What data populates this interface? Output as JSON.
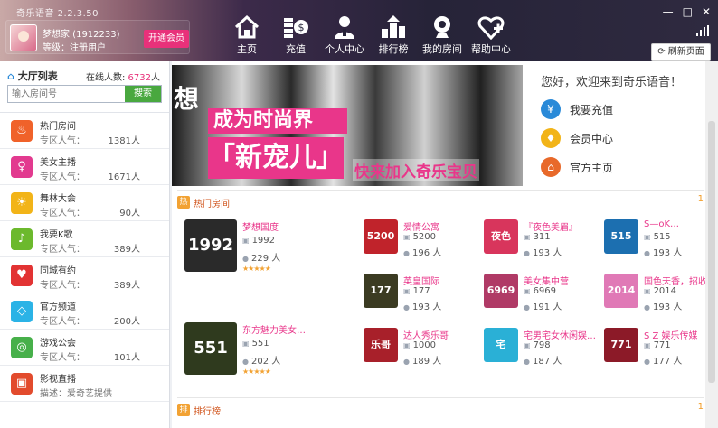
{
  "app": {
    "title": "奇乐语音 2.2.3.50"
  },
  "user": {
    "name": "梦想家 (1912233)",
    "level": "等级：注册用户",
    "vip_button": "开通会员"
  },
  "nav": [
    {
      "label": "主页",
      "icon": "home-icon"
    },
    {
      "label": "充值",
      "icon": "recharge-icon"
    },
    {
      "label": "个人中心",
      "icon": "user-center-icon"
    },
    {
      "label": "排行榜",
      "icon": "ranking-icon"
    },
    {
      "label": "我的房间",
      "icon": "camera-icon"
    },
    {
      "label": "帮助中心",
      "icon": "help-heart-icon"
    }
  ],
  "window": {
    "min": "—",
    "max": "□",
    "close": "✕",
    "refresh": "刷新页面"
  },
  "hall": {
    "title": "大厅列表",
    "online_label": "在线人数:",
    "online_count": "6732",
    "online_unit": "人",
    "search_placeholder": "输入房间号",
    "search_button": "搜索",
    "rooms": [
      {
        "name": "热门房间",
        "sub": "专区人气：",
        "value": "1381人",
        "color": "#f0622a",
        "glyph": "♨"
      },
      {
        "name": "美女主播",
        "sub": "专区人气：",
        "value": "1671人",
        "color": "#e23a8f",
        "glyph": "♀"
      },
      {
        "name": "舞林大会",
        "sub": "专区人气：",
        "value": "90人",
        "color": "#f2b418",
        "glyph": "☀"
      },
      {
        "name": "我要K歌",
        "sub": "专区人气：",
        "value": "389人",
        "color": "#6cb92d",
        "glyph": "♪"
      },
      {
        "name": "同城有约",
        "sub": "专区人气：",
        "value": "389人",
        "color": "#e23333",
        "glyph": "♥"
      },
      {
        "name": "官方频道",
        "sub": "专区人气：",
        "value": "200人",
        "color": "#2bb3e6",
        "glyph": "◇"
      },
      {
        "name": "游戏公会",
        "sub": "专区人气：",
        "value": "101人",
        "color": "#47b04a",
        "glyph": "◎"
      },
      {
        "name": "影视直播",
        "sub": "描述：爱奇艺提供",
        "value": "",
        "color": "#e24b2d",
        "glyph": "▣"
      }
    ]
  },
  "banner": {
    "big_char": "想",
    "line1": "成为时尚界",
    "line2": "「新宠儿」",
    "line3": "快来加入奇乐宝贝"
  },
  "welcome": {
    "title": "您好，欢迎来到奇乐语音！",
    "links": [
      {
        "label": "我要充值",
        "color": "#2a8ad8",
        "glyph": "¥"
      },
      {
        "label": "会员中心",
        "color": "#f2b418",
        "glyph": "♦"
      },
      {
        "label": "官方主页",
        "color": "#e8692a",
        "glyph": "⌂"
      }
    ]
  },
  "hot": {
    "title": "热门房间",
    "more": "1",
    "big": [
      {
        "title": "梦想国度",
        "id": "1992",
        "people": "229 人",
        "stars": "★★★★★",
        "thumb_text": "1992",
        "thumb_color": "#2a2a2a"
      },
      {
        "title": "东方魅力美女…",
        "id": "551",
        "people": "202 人",
        "stars": "★★★★★",
        "thumb_text": "551",
        "thumb_color": "#2f3a1e"
      }
    ],
    "small": [
      {
        "title": "爱情公寓",
        "id": "5200",
        "people": "196 人",
        "thumb_text": "5200",
        "thumb_color": "#c0232b"
      },
      {
        "title": "『夜色美眉』",
        "id": "311",
        "people": "193 人",
        "thumb_text": "夜色",
        "thumb_color": "#d8355c"
      },
      {
        "title": "S—oK…",
        "id": "515",
        "people": "193 人",
        "thumb_text": "515",
        "thumb_color": "#1c6fb0"
      },
      {
        "title": "英皇国际",
        "id": "177",
        "people": "193 人",
        "thumb_text": "177",
        "thumb_color": "#3b3b22"
      },
      {
        "title": "美女集中营",
        "id": "6969",
        "people": "191 人",
        "thumb_text": "6969",
        "thumb_color": "#b03a66"
      },
      {
        "title": "国色天香，招收",
        "id": "2014",
        "people": "193 人",
        "thumb_text": "2014",
        "thumb_color": "#e079b6"
      },
      {
        "title": "达人秀乐哥",
        "id": "1000",
        "people": "189 人",
        "thumb_text": "乐哥",
        "thumb_color": "#a8202a"
      },
      {
        "title": "宅男宅女休闲娱…",
        "id": "798",
        "people": "187 人",
        "thumb_text": "宅",
        "thumb_color": "#2ab0d6"
      },
      {
        "title": "S Z 娱乐传媒",
        "id": "771",
        "people": "177 人",
        "thumb_text": "771",
        "thumb_color": "#8c1a28"
      }
    ]
  },
  "rank": {
    "title": "排行榜",
    "more": "1"
  }
}
